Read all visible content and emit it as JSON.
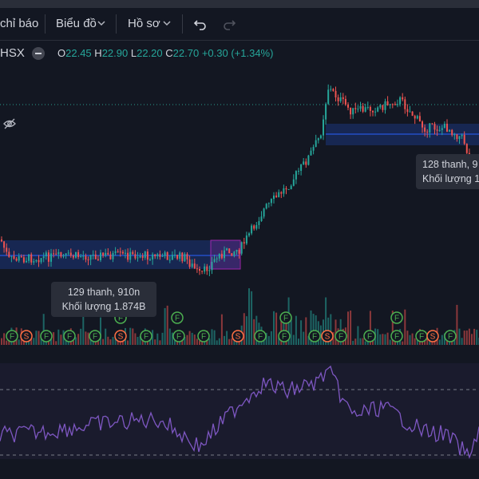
{
  "toolbar": {
    "indicators_label": "chỉ báo",
    "chart_label": "Biểu đồ",
    "profile_label": "Hồ sơ",
    "undo_icon": "undo-icon",
    "redo_icon": "redo-icon"
  },
  "legend": {
    "exchange": "HSX",
    "o_label": "O",
    "o_value": "22.45",
    "h_label": "H",
    "h_value": "22.90",
    "l_label": "L",
    "l_value": "22.20",
    "c_label": "C",
    "c_value": "22.70",
    "change": "+0.30 (+1.34%)"
  },
  "range1": {
    "bars": "129 thanh, 910n",
    "volume": "Khối lượng 1.874B"
  },
  "range2": {
    "bars": "128 thanh, 9",
    "volume": "Khối lượng 1"
  },
  "markers": {
    "foreign": "F",
    "s": "S"
  },
  "colors": {
    "up": "#26a69a",
    "down": "#ef5350",
    "rsi": "#7e57c2",
    "range": "#2962ff",
    "marker_f": "#4caf50",
    "marker_s": "#ff7043"
  }
}
